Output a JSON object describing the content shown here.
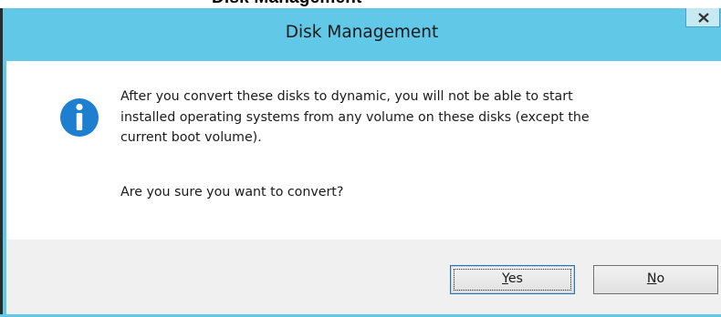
{
  "dialog": {
    "title": "Disk Management",
    "close_glyph": "x",
    "icon": "info-icon",
    "message_lines": [
      "After you convert these disks to dynamic, you will not be able to start",
      "installed operating systems from any volume on these disks (except the",
      "current boot volume)."
    ],
    "question": "Are you sure you want to convert?",
    "buttons": {
      "yes": {
        "mnemonic": "Y",
        "rest": "es"
      },
      "no": {
        "mnemonic": "N",
        "rest": "o"
      }
    }
  },
  "background_caption": "Disk Management",
  "colors": {
    "titlebar": "#61c8e8",
    "button_area": "#f0f0f0",
    "info_icon": "#1e7fd0"
  }
}
